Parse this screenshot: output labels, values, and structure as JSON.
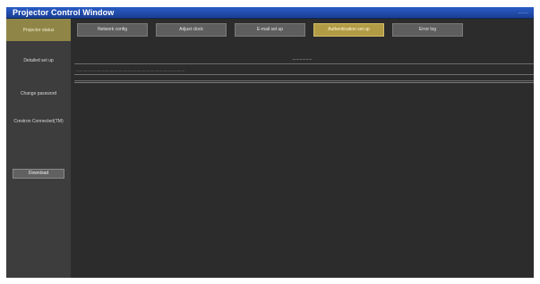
{
  "window": {
    "title": "Projector Control Window",
    "right_text": "........"
  },
  "sidebar": {
    "items": [
      {
        "label": "Projector status"
      },
      {
        "label": "Detailed set up"
      },
      {
        "label": "Change password"
      },
      {
        "label": "Crestron Connected(TM)"
      }
    ],
    "button_label": "Download"
  },
  "tabs": [
    {
      "label": "Network config"
    },
    {
      "label": "Adjust clock"
    },
    {
      "label": "E-mail set up"
    },
    {
      "label": "Authentication set up"
    },
    {
      "label": "Error log"
    }
  ],
  "content": {
    "section_title": "................",
    "status_line": "................................................................................................."
  },
  "colors": {
    "titlebar": "#1f4aa8",
    "active_sidebar": "#8f8546",
    "active_tab": "#b29b45",
    "background": "#2c2c2c"
  }
}
